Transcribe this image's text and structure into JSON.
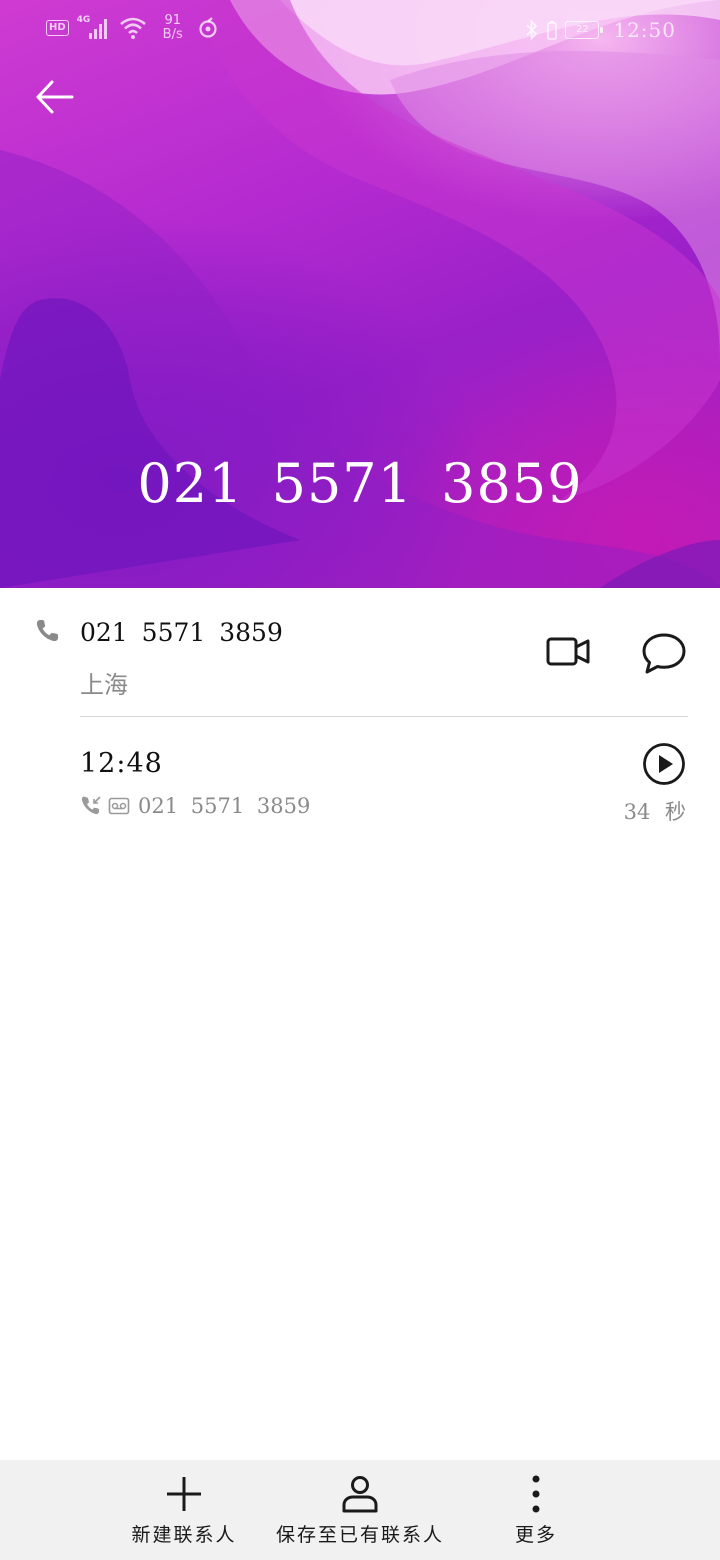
{
  "status_bar": {
    "hd_badge": "HD",
    "network": "4G",
    "net_speed_value": "91",
    "net_speed_unit": "B/s",
    "battery": "22",
    "time": "12:50"
  },
  "header": {
    "number": "021 5571 3859"
  },
  "contact": {
    "number": "021 5571 3859",
    "location": "上海"
  },
  "call_log": {
    "time": "12:48",
    "number": "021 5571 3859",
    "duration": "34 秒"
  },
  "bottom_bar": {
    "new_contact": "新建联系人",
    "save_existing": "保存至已有联系人",
    "more": "更多"
  },
  "colors": {
    "header_primary": "#b42ad0",
    "header_light": "#f6b7f0",
    "header_dark": "#7a18c4",
    "bottom_bar_bg": "#f1f1f1"
  }
}
